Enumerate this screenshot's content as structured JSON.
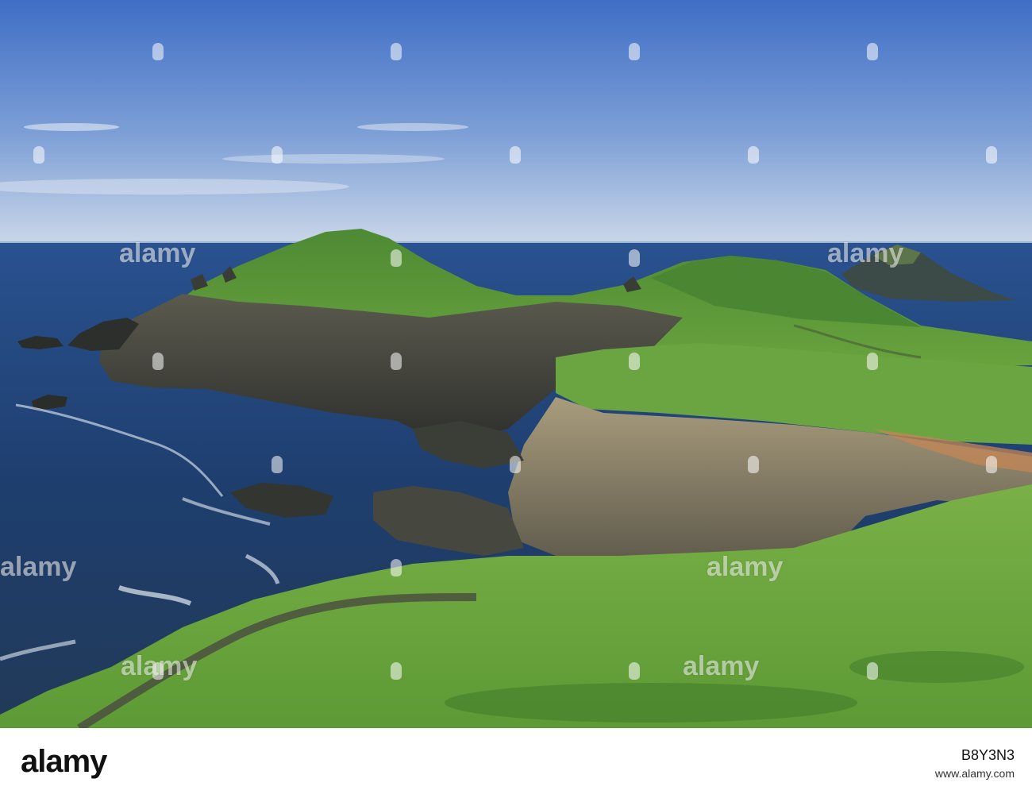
{
  "photo": {
    "subject": "coastal headland with grassy hills, rocky cliffs and an offshore island",
    "sky_color": "#3f6ec6",
    "sea_color": "#1d3b66",
    "grass_color": "#5e9a3a"
  },
  "watermark": {
    "text": "alamy"
  },
  "footer": {
    "logo": "alamy",
    "image_id": "B8Y3N3",
    "site": "www.alamy.com"
  }
}
